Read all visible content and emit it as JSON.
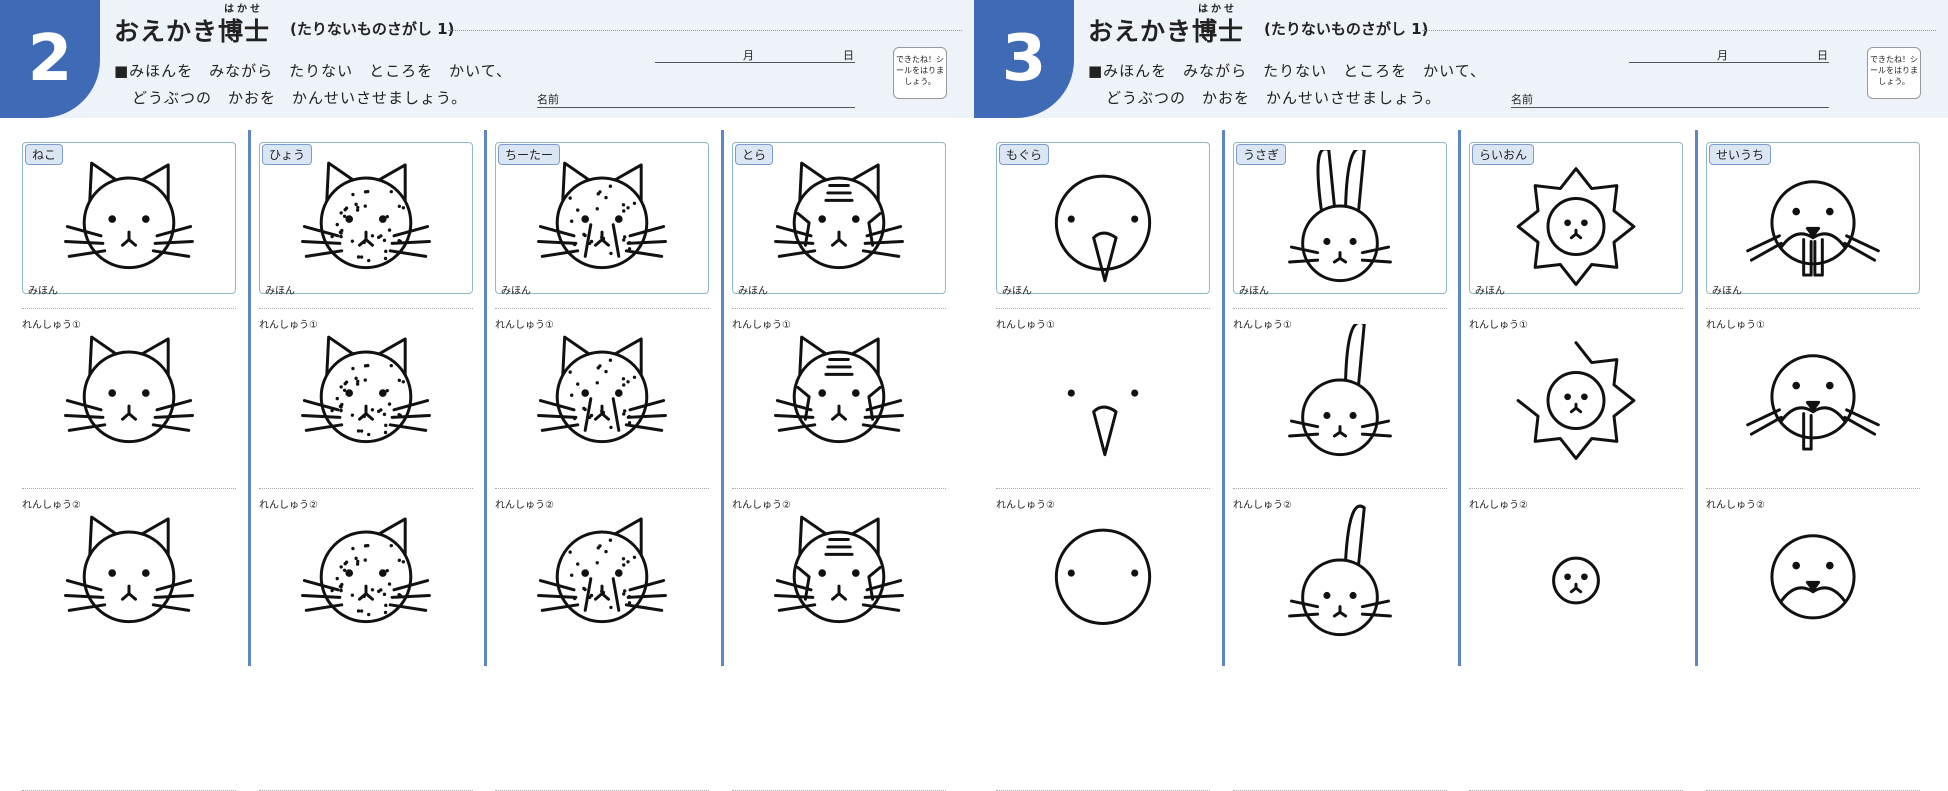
{
  "sheets": [
    {
      "number": "2",
      "title": "おえかき博士",
      "ruby": "はかせ",
      "subtitle": "(たりないものさがし 1)",
      "instruction_line1": "■みほんを　みながら　たりない　ところを　かいて、",
      "instruction_line2": "どうぶつの　かおを　かんせいさせましょう。",
      "month_label": "月",
      "day_label": "日",
      "name_label": "名前",
      "sticker_text": "できたね！シールをはりましょう。",
      "columns": [
        {
          "animal": "ねこ",
          "kind": "cat",
          "model_label": "みほん",
          "practice1": "れんしゅう①",
          "practice2": "れんしゅう②"
        },
        {
          "animal": "ひょう",
          "kind": "leopard",
          "model_label": "みほん",
          "practice1": "れんしゅう①",
          "practice2": "れんしゅう②"
        },
        {
          "animal": "ちーたー",
          "kind": "cheetah",
          "model_label": "みほん",
          "practice1": "れんしゅう①",
          "practice2": "れんしゅう②"
        },
        {
          "animal": "とら",
          "kind": "tiger",
          "model_label": "みほん",
          "practice1": "れんしゅう①",
          "practice2": "れんしゅう②"
        }
      ]
    },
    {
      "number": "3",
      "title": "おえかき博士",
      "ruby": "はかせ",
      "subtitle": "(たりないものさがし 1)",
      "instruction_line1": "■みほんを　みながら　たりない　ところを　かいて、",
      "instruction_line2": "どうぶつの　かおを　かんせいさせましょう。",
      "month_label": "月",
      "day_label": "日",
      "name_label": "名前",
      "sticker_text": "できたね！シールをはりましょう。",
      "columns": [
        {
          "animal": "もぐら",
          "kind": "mole",
          "model_label": "みほん",
          "practice1": "れんしゅう①",
          "practice2": "れんしゅう②"
        },
        {
          "animal": "うさぎ",
          "kind": "rabbit",
          "model_label": "みほん",
          "practice1": "れんしゅう①",
          "practice2": "れんしゅう②"
        },
        {
          "animal": "らいおん",
          "kind": "lion",
          "model_label": "みほん",
          "practice1": "れんしゅう①",
          "practice2": "れんしゅう②"
        },
        {
          "animal": "せいうち",
          "kind": "walrus",
          "model_label": "みほん",
          "practice1": "れんしゅう①",
          "practice2": "れんしゅう②"
        }
      ]
    }
  ],
  "colors": {
    "accent": "#3f6ab5",
    "header_bg": "#eef2f9",
    "separator": "#5e86c4",
    "tag_bg": "#dbe6f5"
  }
}
